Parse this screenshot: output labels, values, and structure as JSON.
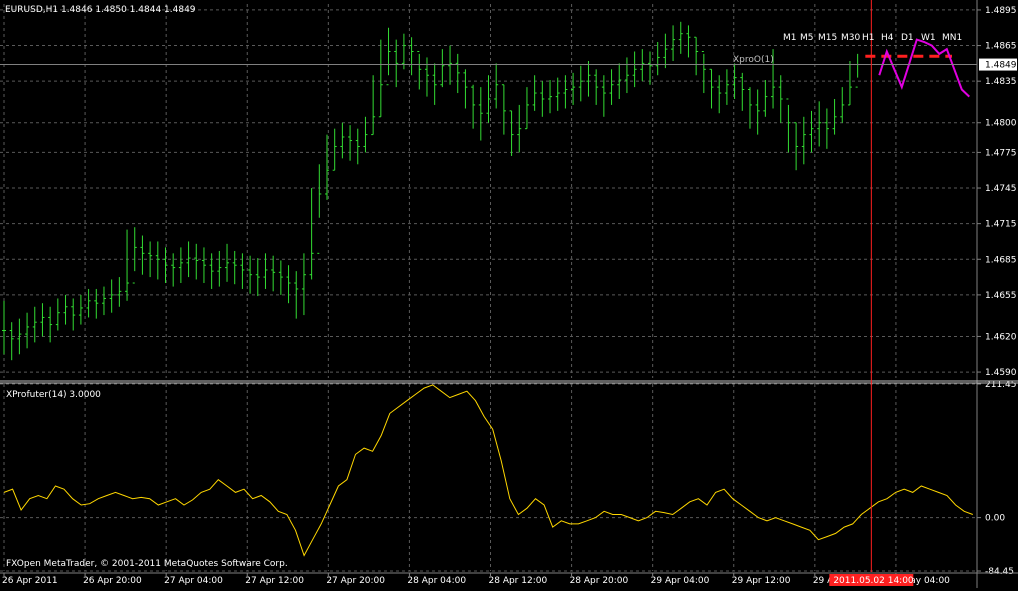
{
  "window": {
    "symbol_info": "EURUSD,H1  1.4846 1.4850 1.4844 1.4849",
    "indicator_label": "XProfuter(14) 3.0000",
    "copyright": "FXOpen MetaTrader, © 2001-2011 MetaQuotes Software Corp.",
    "current_price_label": "1.4849",
    "cursor_time_label": "2011.05.02 14:00",
    "xpro_label": "XproO(1)"
  },
  "timeframes": [
    "M1",
    "M5",
    "M15",
    "M30",
    "H1",
    "H4",
    "D1",
    "W1",
    "MN1"
  ],
  "colors": {
    "background": "#000000",
    "grid": "#5a5a5a",
    "bars": "#33dd33",
    "indicator_line": "#ffd700",
    "xpro_line": "#e000e0",
    "xpro_level": "#ff2020",
    "cursor_line": "#ff2020",
    "axis_text": "#ffffff"
  },
  "chart_data": [
    {
      "type": "ohlc",
      "title": "EURUSD,H1",
      "y_axis_ticks": [
        "1.4895",
        "1.4865",
        "1.4835",
        "1.4800",
        "1.4775",
        "1.4745",
        "1.4715",
        "1.4685",
        "1.4655",
        "1.4620",
        "1.4590"
      ],
      "ylim": [
        1.4585,
        1.49
      ],
      "x_tick_labels": [
        "26 Apr 2011",
        "26 Apr 20:00",
        "27 Apr 04:00",
        "27 Apr 12:00",
        "27 Apr 20:00",
        "28 Apr 04:00",
        "28 Apr 12:00",
        "28 Apr 20:00",
        "29 Apr 04:00",
        "29 Apr 12:00",
        "29 Apr 20:00",
        "2 May 04:00"
      ],
      "close": [
        1.4625,
        1.4618,
        1.4622,
        1.4628,
        1.4632,
        1.4636,
        1.463,
        1.464,
        1.4645,
        1.4638,
        1.4644,
        1.465,
        1.4648,
        1.4652,
        1.4655,
        1.4658,
        1.4665,
        1.4695,
        1.469,
        1.4688,
        1.4685,
        1.468,
        1.4678,
        1.4682,
        1.4686,
        1.4684,
        1.468,
        1.4675,
        1.4678,
        1.4682,
        1.468,
        1.4676,
        1.4672,
        1.467,
        1.4676,
        1.4674,
        1.467,
        1.4665,
        1.466,
        1.4672,
        1.469,
        1.474,
        1.476,
        1.478,
        1.4788,
        1.4785,
        1.478,
        1.479,
        1.4805,
        1.4832,
        1.486,
        1.485,
        1.4865,
        1.486,
        1.4845,
        1.484,
        1.4832,
        1.4848,
        1.485,
        1.4842,
        1.483,
        1.4815,
        1.4808,
        1.482,
        1.4832,
        1.481,
        1.479,
        1.4795,
        1.4815,
        1.4825,
        1.482,
        1.4822,
        1.4825,
        1.4828,
        1.483,
        1.4835,
        1.484,
        1.483,
        1.4825,
        1.4832,
        1.4836,
        1.484,
        1.4845,
        1.485,
        1.4848,
        1.4855,
        1.4862,
        1.487,
        1.4875,
        1.4872,
        1.486,
        1.4845,
        1.483,
        1.4825,
        1.4832,
        1.4838,
        1.4828,
        1.4815,
        1.481,
        1.4822,
        1.483,
        1.482,
        1.48,
        1.478,
        1.479,
        1.4795,
        1.48,
        1.4795,
        1.4805,
        1.4815,
        1.483,
        1.4849
      ],
      "high": [
        1.465,
        1.4632,
        1.4635,
        1.464,
        1.4645,
        1.4648,
        1.4645,
        1.4652,
        1.4655,
        1.4652,
        1.4655,
        1.466,
        1.466,
        1.4662,
        1.4668,
        1.467,
        1.471,
        1.4712,
        1.4705,
        1.47,
        1.47,
        1.4695,
        1.469,
        1.4695,
        1.47,
        1.4698,
        1.4695,
        1.469,
        1.4692,
        1.4698,
        1.4692,
        1.469,
        1.4688,
        1.4686,
        1.469,
        1.4688,
        1.4684,
        1.468,
        1.4675,
        1.469,
        1.4745,
        1.4765,
        1.479,
        1.4795,
        1.48,
        1.4798,
        1.4795,
        1.4805,
        1.484,
        1.487,
        1.488,
        1.487,
        1.4875,
        1.4872,
        1.4858,
        1.4855,
        1.485,
        1.4862,
        1.4865,
        1.4858,
        1.4845,
        1.4832,
        1.483,
        1.484,
        1.485,
        1.4832,
        1.481,
        1.4815,
        1.483,
        1.484,
        1.4835,
        1.4836,
        1.4838,
        1.484,
        1.4842,
        1.4848,
        1.4852,
        1.4845,
        1.484,
        1.4845,
        1.485,
        1.4855,
        1.486,
        1.4862,
        1.486,
        1.4868,
        1.4875,
        1.4882,
        1.4885,
        1.4882,
        1.4872,
        1.4858,
        1.4845,
        1.484,
        1.4845,
        1.485,
        1.4842,
        1.483,
        1.4828,
        1.4836,
        1.4862,
        1.484,
        1.4815,
        1.48,
        1.4805,
        1.481,
        1.4818,
        1.4812,
        1.482,
        1.483,
        1.4852,
        1.4858
      ],
      "low": [
        1.4605,
        1.46,
        1.4605,
        1.461,
        1.4615,
        1.462,
        1.4615,
        1.4625,
        1.463,
        1.4625,
        1.463,
        1.4636,
        1.4635,
        1.4638,
        1.464,
        1.4645,
        1.465,
        1.4675,
        1.4672,
        1.467,
        1.4668,
        1.4665,
        1.4662,
        1.4665,
        1.467,
        1.4668,
        1.4665,
        1.466,
        1.4662,
        1.4666,
        1.4664,
        1.466,
        1.4656,
        1.4654,
        1.466,
        1.4658,
        1.4655,
        1.4648,
        1.4635,
        1.4638,
        1.4668,
        1.472,
        1.4735,
        1.476,
        1.477,
        1.4768,
        1.4765,
        1.4775,
        1.479,
        1.4805,
        1.484,
        1.483,
        1.4845,
        1.484,
        1.4828,
        1.4822,
        1.4815,
        1.483,
        1.4832,
        1.4825,
        1.4812,
        1.4795,
        1.4785,
        1.48,
        1.4812,
        1.479,
        1.4772,
        1.4775,
        1.4795,
        1.481,
        1.4805,
        1.4808,
        1.481,
        1.4812,
        1.4815,
        1.4818,
        1.4822,
        1.4815,
        1.4805,
        1.4815,
        1.482,
        1.4825,
        1.483,
        1.4835,
        1.4832,
        1.484,
        1.4846,
        1.4852,
        1.4858,
        1.4855,
        1.484,
        1.4825,
        1.4812,
        1.4808,
        1.4815,
        1.482,
        1.481,
        1.4795,
        1.479,
        1.4805,
        1.4812,
        1.48,
        1.4775,
        1.476,
        1.4765,
        1.4775,
        1.478,
        1.4778,
        1.479,
        1.48,
        1.4815,
        1.4838
      ],
      "current_price": 1.4849
    },
    {
      "type": "line",
      "title": "XProfuter(14) 3.0000",
      "y_axis_ticks": [
        "211.45",
        "0.00",
        "-84.45"
      ],
      "ylim": [
        -84.45,
        211.45
      ],
      "series": [
        {
          "values": [
            40,
            45,
            12,
            30,
            35,
            30,
            50,
            45,
            30,
            20,
            22,
            30,
            35,
            40,
            35,
            30,
            32,
            30,
            20,
            25,
            30,
            20,
            28,
            40,
            45,
            60,
            50,
            40,
            45,
            30,
            35,
            25,
            10,
            5,
            -20,
            -60,
            -35,
            -10,
            20,
            50,
            60,
            100,
            110,
            105,
            130,
            165,
            175,
            185,
            195,
            205,
            210,
            200,
            190,
            195,
            200,
            185,
            160,
            140,
            90,
            30,
            5,
            15,
            30,
            20,
            -15,
            -5,
            -10,
            -10,
            -5,
            0,
            10,
            5,
            5,
            0,
            -5,
            0,
            10,
            8,
            5,
            15,
            25,
            30,
            20,
            40,
            45,
            30,
            20,
            10,
            0,
            -5,
            0,
            -5,
            -10,
            -15,
            -20,
            -35,
            -30,
            -25,
            -15,
            -10,
            5,
            15,
            25,
            30,
            40,
            45,
            40,
            50,
            45,
            40,
            35,
            20,
            10,
            5
          ]
        }
      ],
      "xpro_forecast": [
        1.484,
        1.486,
        1.4845,
        1.483,
        1.485,
        1.487,
        1.4868,
        1.4865,
        1.4858,
        1.4862,
        1.4845,
        1.4828,
        1.4822
      ],
      "xpro_level": 1.4856
    }
  ]
}
